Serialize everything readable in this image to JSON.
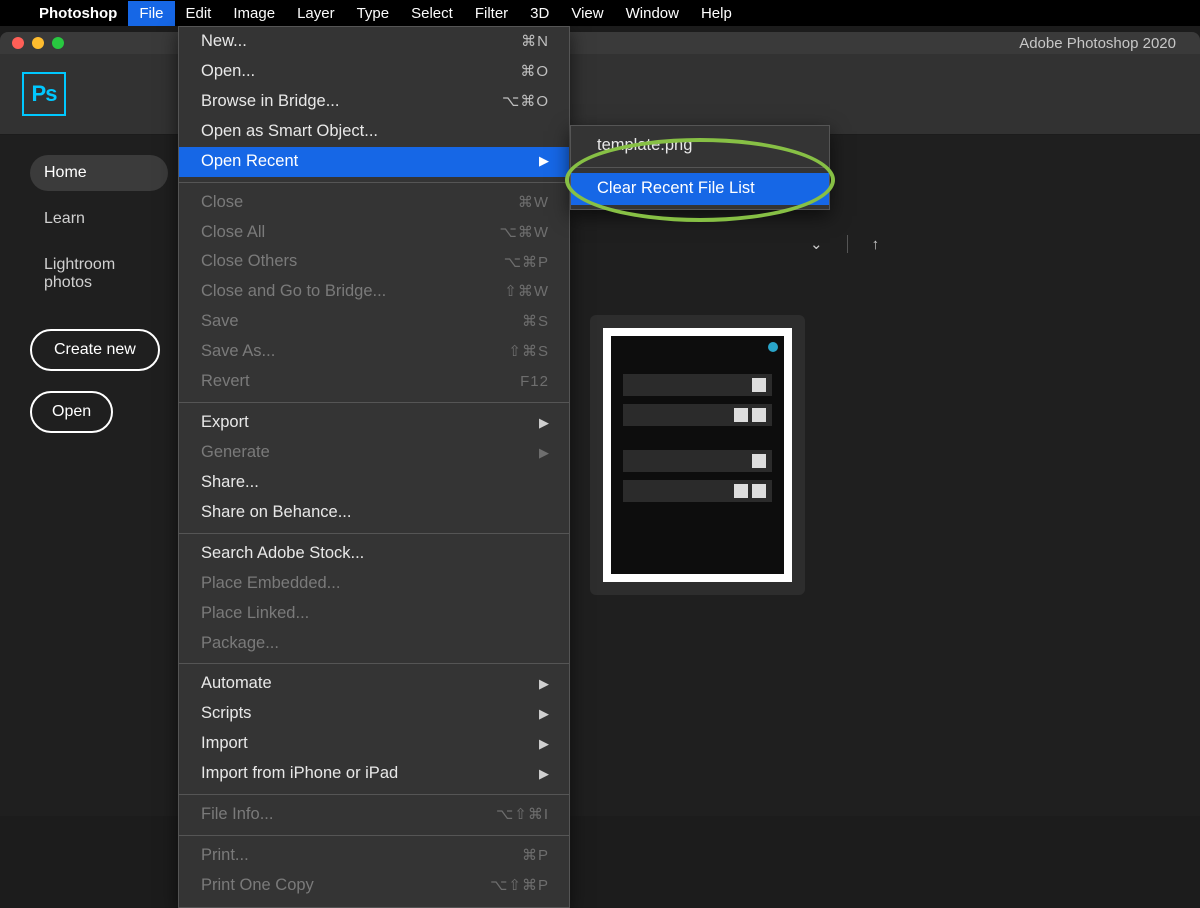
{
  "menubar": {
    "app": "Photoshop",
    "items": [
      "File",
      "Edit",
      "Image",
      "Layer",
      "Type",
      "Select",
      "Filter",
      "3D",
      "View",
      "Window",
      "Help"
    ],
    "open_index": 0
  },
  "window": {
    "title": "Adobe Photoshop 2020",
    "logo_text": "Ps"
  },
  "sidebar": {
    "items": [
      "Home",
      "Learn",
      "Lightroom photos"
    ],
    "active_index": 0,
    "create_btn": "Create new",
    "open_btn": "Open"
  },
  "file_menu": [
    {
      "label": "New...",
      "shortcut": "⌘N"
    },
    {
      "label": "Open...",
      "shortcut": "⌘O"
    },
    {
      "label": "Browse in Bridge...",
      "shortcut": "⌥⌘O"
    },
    {
      "label": "Open as Smart Object..."
    },
    {
      "label": "Open Recent",
      "submenu": true,
      "highlight": true
    },
    {
      "sep": true
    },
    {
      "label": "Close",
      "shortcut": "⌘W",
      "disabled": true
    },
    {
      "label": "Close All",
      "shortcut": "⌥⌘W",
      "disabled": true
    },
    {
      "label": "Close Others",
      "shortcut": "⌥⌘P",
      "disabled": true
    },
    {
      "label": "Close and Go to Bridge...",
      "shortcut": "⇧⌘W",
      "disabled": true
    },
    {
      "label": "Save",
      "shortcut": "⌘S",
      "disabled": true
    },
    {
      "label": "Save As...",
      "shortcut": "⇧⌘S",
      "disabled": true
    },
    {
      "label": "Revert",
      "shortcut": "F12",
      "disabled": true
    },
    {
      "sep": true
    },
    {
      "label": "Export",
      "submenu": true
    },
    {
      "label": "Generate",
      "submenu": true,
      "disabled": true
    },
    {
      "label": "Share..."
    },
    {
      "label": "Share on Behance..."
    },
    {
      "sep": true
    },
    {
      "label": "Search Adobe Stock..."
    },
    {
      "label": "Place Embedded...",
      "disabled": true
    },
    {
      "label": "Place Linked...",
      "disabled": true
    },
    {
      "label": "Package...",
      "disabled": true
    },
    {
      "sep": true
    },
    {
      "label": "Automate",
      "submenu": true
    },
    {
      "label": "Scripts",
      "submenu": true
    },
    {
      "label": "Import",
      "submenu": true
    },
    {
      "label": "Import from iPhone or iPad",
      "submenu": true
    },
    {
      "sep": true
    },
    {
      "label": "File Info...",
      "shortcut": "⌥⇧⌘I",
      "disabled": true
    },
    {
      "sep": true
    },
    {
      "label": "Print...",
      "shortcut": "⌘P",
      "disabled": true
    },
    {
      "label": "Print One Copy",
      "shortcut": "⌥⇧⌘P",
      "disabled": true
    }
  ],
  "open_recent_submenu": {
    "recent_file": "template.png",
    "clear_label": "Clear Recent File List"
  }
}
